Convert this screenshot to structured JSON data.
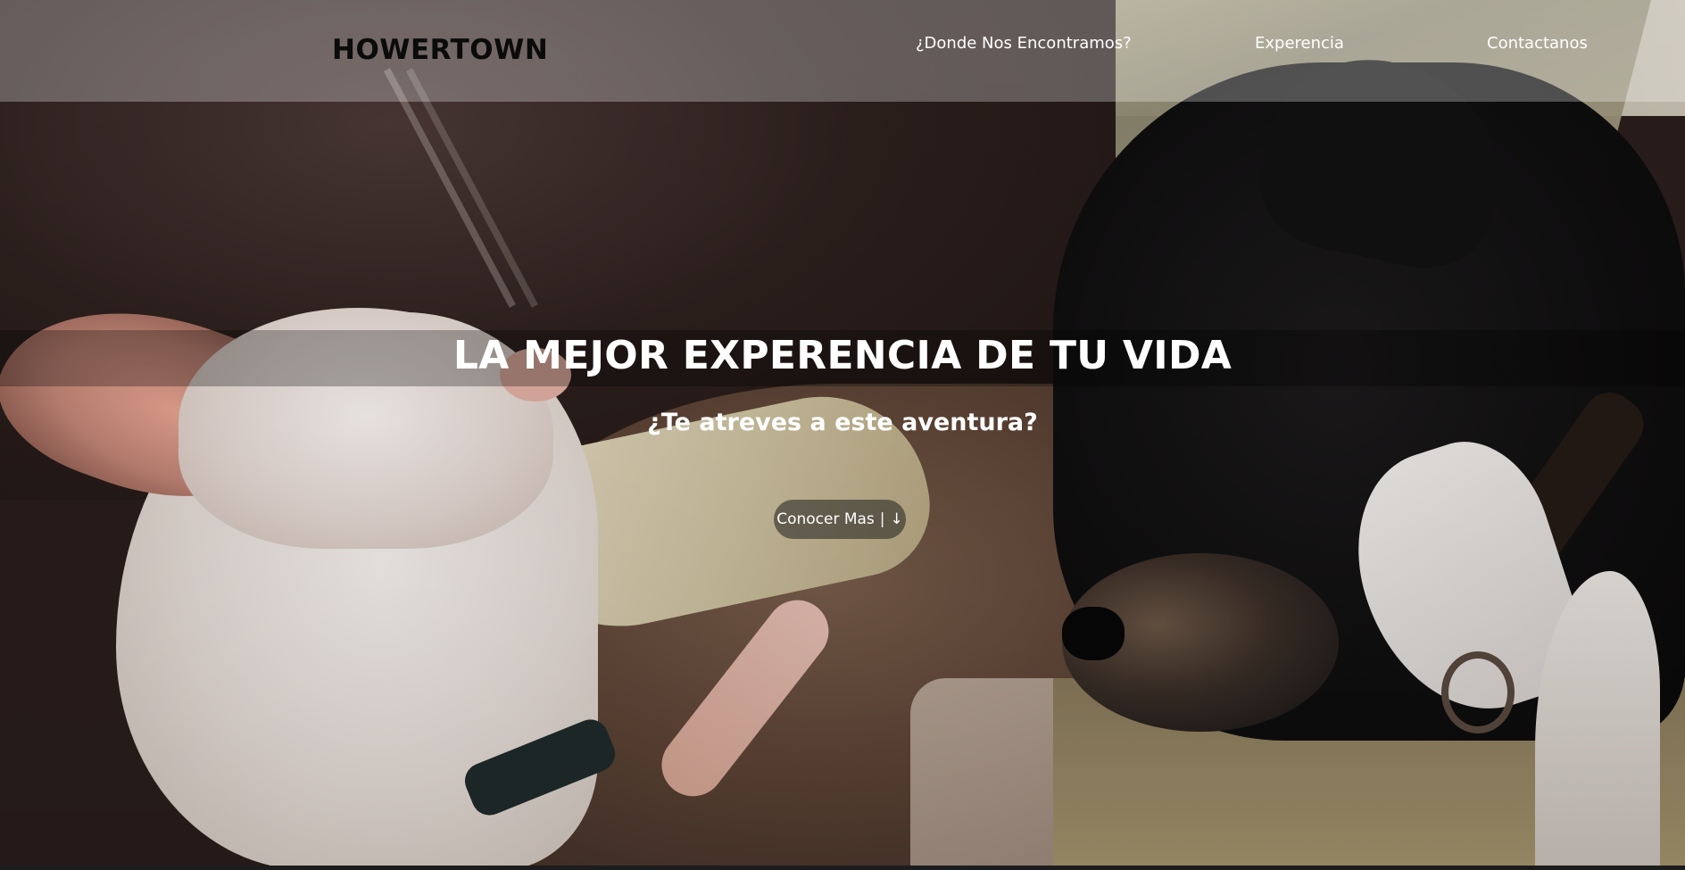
{
  "header": {
    "brand": "HOWERTOWN",
    "nav": [
      {
        "label": "¿Donde Nos Encontramos?"
      },
      {
        "label": "Experencia"
      },
      {
        "label": "Contactanos"
      }
    ]
  },
  "hero": {
    "title": "LA MEJOR EXPERENCIA DE TU VIDA",
    "subtitle": "¿Te atreves a este aventura?",
    "cta_label": "Conocer Mas",
    "cta_separator": "|",
    "cta_arrow": "↓",
    "background_image": "photo of a small white dog and a black dog sleeping on a couch"
  },
  "colors": {
    "nav_overlay": "#ffffff",
    "brand_text": "#0b0b0b",
    "hero_text": "#ffffff"
  }
}
